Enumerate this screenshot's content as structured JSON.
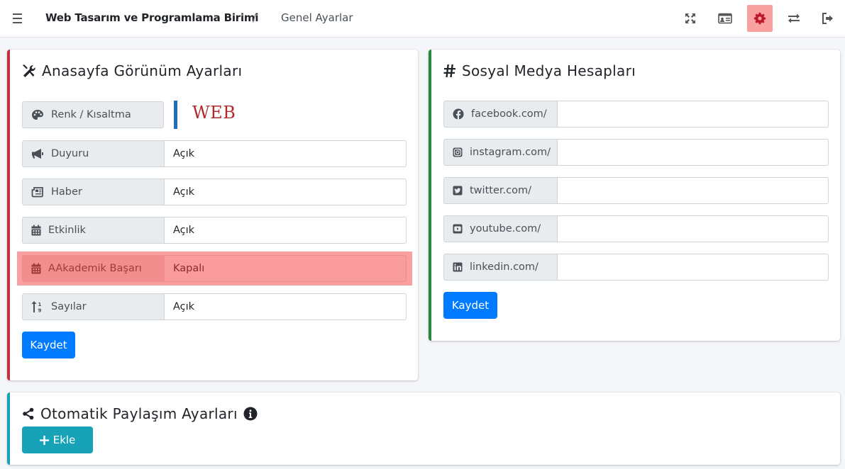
{
  "navbar": {
    "menu_icon": "bars-icon",
    "brand": "Web Tasarım ve Programlama Birimi",
    "separator": "/",
    "breadcrumb": "Genel Ayarlar",
    "icons": [
      "expand-icon",
      "id-card-icon",
      "cog-icon",
      "exchange-icon",
      "sign-out-icon"
    ],
    "active_color": "#f9a0a0"
  },
  "home_settings": {
    "title": "Anasayfa Görünüm Ayarları",
    "icon": "tools-icon",
    "accent": "#c0303d",
    "color_row": {
      "label": "Renk / Kısaltma",
      "icon": "palette-icon",
      "swatch_color": "#1e6fb5",
      "abbr": "WEB"
    },
    "rows": [
      {
        "label": "Duyuru",
        "icon": "bullhorn-icon",
        "value": "Açık"
      },
      {
        "label": "Haber",
        "icon": "newspaper-icon",
        "value": "Açık"
      },
      {
        "label": "Etkinlik",
        "icon": "calendar-icon",
        "value": "Açık"
      },
      {
        "label": "AAkademik Başarı",
        "icon": "calendar-icon",
        "value": "Kapalı"
      },
      {
        "label": "Sayılar",
        "icon": "sort-numeric-icon",
        "value": "Açık"
      }
    ],
    "save_label": "Kaydet"
  },
  "social": {
    "title": "Sosyal Medya Hesapları",
    "icon": "hashtag-icon",
    "accent": "#28873f",
    "rows": [
      {
        "label": "facebook.com/",
        "icon": "facebook-icon",
        "value": ""
      },
      {
        "label": "instagram.com/",
        "icon": "instagram-icon",
        "value": ""
      },
      {
        "label": "twitter.com/",
        "icon": "twitter-icon",
        "value": ""
      },
      {
        "label": "youtube.com/",
        "icon": "youtube-icon",
        "value": ""
      },
      {
        "label": "linkedin.com/",
        "icon": "linkedin-icon",
        "value": ""
      }
    ],
    "save_label": "Kaydet"
  },
  "auto_share": {
    "title": "Otomatik Paylaşım Ayarları",
    "icon": "share-icon",
    "info_icon": "info-circle-icon",
    "accent": "#17a2b8",
    "add_label": "Ekle",
    "add_icon": "plus-icon"
  }
}
